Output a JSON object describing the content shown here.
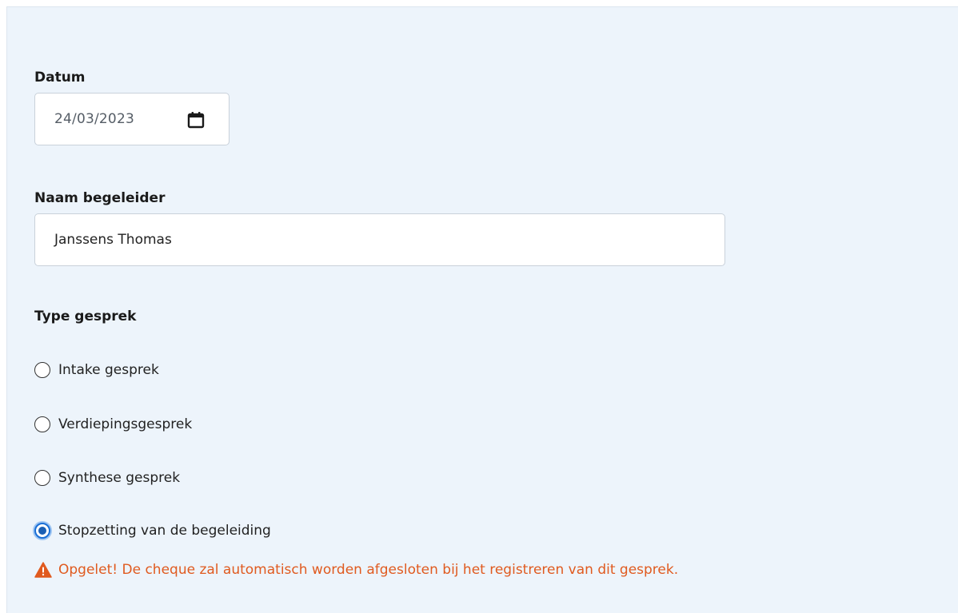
{
  "form": {
    "date_label": "Datum",
    "date_value": "24/03/2023",
    "name_label": "Naam begeleider",
    "name_value": "Janssens Thomas",
    "type_label": "Type gesprek",
    "options": [
      {
        "label": "Intake gesprek",
        "selected": false
      },
      {
        "label": "Verdiepingsgesprek",
        "selected": false
      },
      {
        "label": "Synthese gesprek",
        "selected": false
      },
      {
        "label": "Stopzetting van de begeleiding",
        "selected": true
      }
    ],
    "warning_text": "Opgelet! De cheque zal automatisch worden afgesloten bij het registreren van dit gesprek."
  },
  "icons": {
    "date": "calendar-icon",
    "warning": "warning-triangle-icon"
  },
  "colors": {
    "panel_bg": "#edf4fb",
    "warning": "#e05a1f",
    "radio_selected": "#1a5fb4"
  }
}
